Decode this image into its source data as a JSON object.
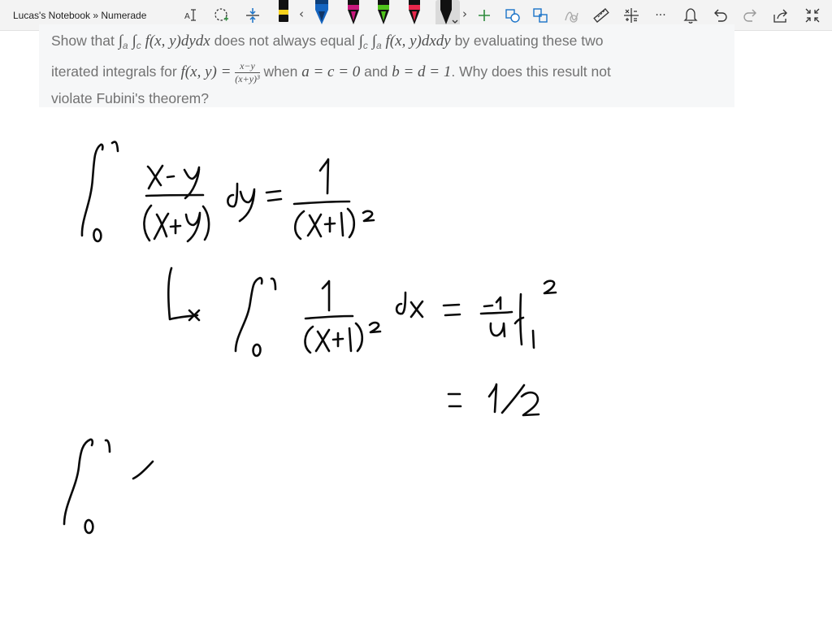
{
  "app": {
    "title": "Lucas's Notebook » Numerade"
  },
  "toolbar": {
    "icons": [
      "text-mode-icon",
      "lasso-select-icon",
      "insert-space-icon",
      "scroll-left-icon",
      "scroll-right-icon",
      "add-pen-icon",
      "shapes-icon",
      "ink-to-shape-icon",
      "ink-replay-icon",
      "ruler-icon",
      "ink-to-math-icon",
      "more-icon",
      "notifications-icon",
      "undo-icon",
      "redo-icon",
      "share-icon",
      "fullscreen-icon"
    ],
    "pens": [
      {
        "name": "black-highlighter",
        "color": "#111111",
        "band": "#f7d21c"
      },
      {
        "name": "blue-pen",
        "color": "#1565c0"
      },
      {
        "name": "pink-pen",
        "color": "#c8187d"
      },
      {
        "name": "green-pen",
        "color": "#4fc21b"
      },
      {
        "name": "red-pen",
        "color": "#e8274b"
      },
      {
        "name": "selected-black-pen",
        "color": "#111111",
        "selected": true
      }
    ],
    "scroll_left_glyph": "‹",
    "scroll_right_glyph": "›",
    "more_glyph": "···"
  },
  "question": {
    "t1": "Show that ",
    "t1_math": "∫",
    "t1_math_sub_a": "a",
    "t1_math_sub_c": "c",
    "t1_math_expr": "f(x, y)dydx",
    "t2": " does not always equal ",
    "t2_math_sub_c": "c",
    "t2_math_sub_a": "a",
    "t2_math_expr": "f(x, y)dxdy",
    "t3": " by evaluating these two",
    "t4": "iterated integrals for ",
    "t4_math": "f(x, y) =",
    "frac_num": "x−y",
    "frac_den": "(x+y)³",
    "t5": " when ",
    "t5_math": "a = c = 0",
    "t6": " and ",
    "t6_math": "b = d = 1",
    "t7": ". Why does this result not",
    "t8": "violate Fubini's theorem?"
  },
  "colors": {
    "toolbar_bg": "#f3f3f3",
    "card_bg": "#f6f7f8",
    "question_text": "#727272",
    "ink": "#0a0a0a",
    "highlighter_yellow": "#f7d21c"
  }
}
